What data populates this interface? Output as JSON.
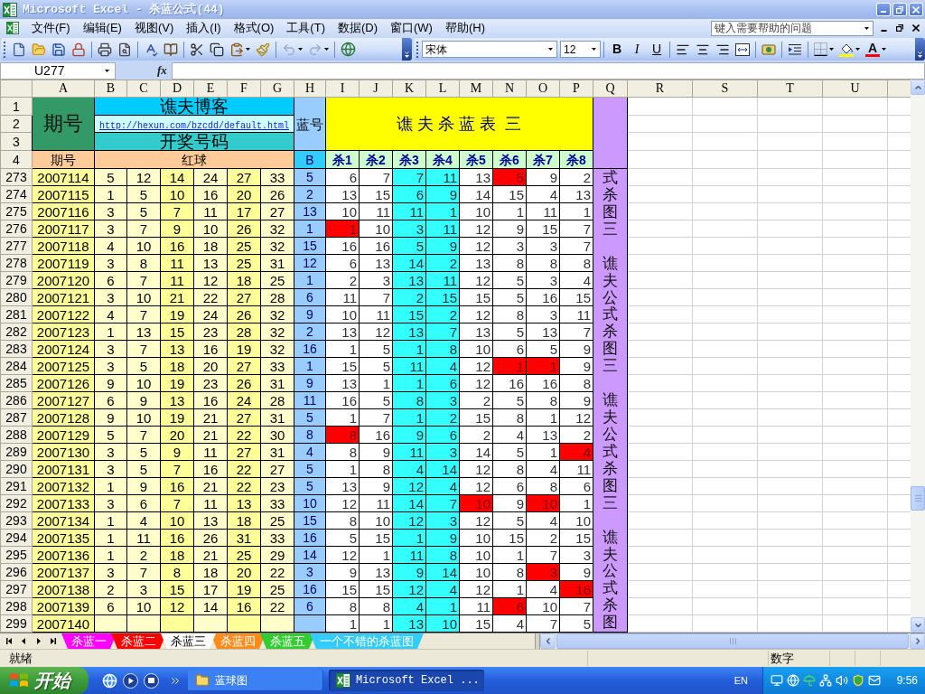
{
  "window": {
    "title": "Microsoft Excel - 杀蓝公式(44)"
  },
  "menu_bar": {
    "items": [
      "文件(F)",
      "编辑(E)",
      "视图(V)",
      "插入(I)",
      "格式(O)",
      "工具(T)",
      "数据(D)",
      "窗口(W)",
      "帮助(H)"
    ],
    "help_box": {
      "placeholder": "键入需要帮助的问题"
    }
  },
  "toolbar": {
    "undo": {
      "disabled": true
    },
    "redo": {
      "disabled": true
    },
    "font_name": "宋体",
    "font_size": "12",
    "format_buttons": [
      "B",
      "I",
      "U"
    ],
    "font_color_glyph": "A"
  },
  "formula_bar": {
    "name_box": "U277",
    "function_label": "fx"
  },
  "sheet": {
    "columns": [
      "A",
      "B",
      "C",
      "D",
      "E",
      "F",
      "G",
      "H",
      "I",
      "J",
      "K",
      "L",
      "M",
      "N",
      "O",
      "P",
      "Q",
      "R",
      "S",
      "T",
      "U"
    ],
    "header": {
      "row_numbers": [
        "1",
        "2",
        "3",
        "4"
      ],
      "period_label": "期号",
      "blog_title": "谯夫博客",
      "blog_link": "http://hexun.com/bzcdd/default.html",
      "draw_label": "开奖号码",
      "blue_label": "蓝号",
      "table_title": "谯 夫 杀 蓝 表  三",
      "period_heading": "期号",
      "red_heading": "红球",
      "blue_heading": "B",
      "kill_headings": [
        "杀1",
        "杀2",
        "杀3",
        "杀4",
        "杀5",
        "杀6",
        "杀7",
        "杀8"
      ]
    },
    "rows": [
      {
        "number": "273",
        "issue": "2007114",
        "reds": [
          "5",
          "12",
          "14",
          "24",
          "27",
          "33"
        ],
        "blue": "5",
        "kills": [
          {
            "value": "6",
            "hit": false
          },
          {
            "value": "7",
            "hit": false
          },
          {
            "value": "7",
            "hit": false
          },
          {
            "value": "11",
            "hit": false
          },
          {
            "value": "13",
            "hit": false
          },
          {
            "value": "5",
            "hit": true
          },
          {
            "value": "9",
            "hit": false
          },
          {
            "value": "2",
            "hit": false
          }
        ]
      },
      {
        "number": "274",
        "issue": "2007115",
        "reds": [
          "1",
          "5",
          "10",
          "16",
          "20",
          "26"
        ],
        "blue": "2",
        "kills": [
          {
            "value": "13",
            "hit": false
          },
          {
            "value": "15",
            "hit": false
          },
          {
            "value": "6",
            "hit": false
          },
          {
            "value": "9",
            "hit": false
          },
          {
            "value": "14",
            "hit": false
          },
          {
            "value": "15",
            "hit": false
          },
          {
            "value": "4",
            "hit": false
          },
          {
            "value": "13",
            "hit": false
          }
        ]
      },
      {
        "number": "275",
        "issue": "2007116",
        "reds": [
          "3",
          "5",
          "7",
          "11",
          "17",
          "27"
        ],
        "blue": "13",
        "kills": [
          {
            "value": "10",
            "hit": false
          },
          {
            "value": "11",
            "hit": false
          },
          {
            "value": "11",
            "hit": false
          },
          {
            "value": "1",
            "hit": false
          },
          {
            "value": "10",
            "hit": false
          },
          {
            "value": "1",
            "hit": false
          },
          {
            "value": "11",
            "hit": false
          },
          {
            "value": "1",
            "hit": false
          }
        ]
      },
      {
        "number": "276",
        "issue": "2007117",
        "reds": [
          "3",
          "7",
          "9",
          "10",
          "26",
          "32"
        ],
        "blue": "1",
        "kills": [
          {
            "value": "1",
            "hit": true
          },
          {
            "value": "10",
            "hit": false
          },
          {
            "value": "3",
            "hit": false
          },
          {
            "value": "11",
            "hit": false
          },
          {
            "value": "12",
            "hit": false
          },
          {
            "value": "9",
            "hit": false
          },
          {
            "value": "15",
            "hit": false
          },
          {
            "value": "7",
            "hit": false
          }
        ]
      },
      {
        "number": "277",
        "issue": "2007118",
        "reds": [
          "4",
          "10",
          "16",
          "18",
          "25",
          "32"
        ],
        "blue": "15",
        "kills": [
          {
            "value": "16",
            "hit": false
          },
          {
            "value": "16",
            "hit": false
          },
          {
            "value": "5",
            "hit": false
          },
          {
            "value": "9",
            "hit": false
          },
          {
            "value": "12",
            "hit": false
          },
          {
            "value": "3",
            "hit": false
          },
          {
            "value": "3",
            "hit": false
          },
          {
            "value": "7",
            "hit": false
          }
        ]
      },
      {
        "number": "278",
        "issue": "2007119",
        "reds": [
          "3",
          "8",
          "11",
          "13",
          "25",
          "31"
        ],
        "blue": "12",
        "kills": [
          {
            "value": "6",
            "hit": false
          },
          {
            "value": "13",
            "hit": false
          },
          {
            "value": "14",
            "hit": false
          },
          {
            "value": "2",
            "hit": false
          },
          {
            "value": "13",
            "hit": false
          },
          {
            "value": "8",
            "hit": false
          },
          {
            "value": "8",
            "hit": false
          },
          {
            "value": "8",
            "hit": false
          }
        ]
      },
      {
        "number": "279",
        "issue": "2007120",
        "reds": [
          "6",
          "7",
          "11",
          "12",
          "18",
          "25"
        ],
        "blue": "1",
        "kills": [
          {
            "value": "2",
            "hit": false
          },
          {
            "value": "3",
            "hit": false
          },
          {
            "value": "13",
            "hit": false
          },
          {
            "value": "11",
            "hit": false
          },
          {
            "value": "12",
            "hit": false
          },
          {
            "value": "5",
            "hit": false
          },
          {
            "value": "3",
            "hit": false
          },
          {
            "value": "4",
            "hit": false
          }
        ]
      },
      {
        "number": "280",
        "issue": "2007121",
        "reds": [
          "3",
          "10",
          "21",
          "22",
          "27",
          "28"
        ],
        "blue": "6",
        "kills": [
          {
            "value": "11",
            "hit": false
          },
          {
            "value": "7",
            "hit": false
          },
          {
            "value": "2",
            "hit": false
          },
          {
            "value": "15",
            "hit": false
          },
          {
            "value": "15",
            "hit": false
          },
          {
            "value": "5",
            "hit": false
          },
          {
            "value": "16",
            "hit": false
          },
          {
            "value": "15",
            "hit": false
          }
        ]
      },
      {
        "number": "281",
        "issue": "2007122",
        "reds": [
          "4",
          "7",
          "19",
          "24",
          "26",
          "32"
        ],
        "blue": "9",
        "kills": [
          {
            "value": "10",
            "hit": false
          },
          {
            "value": "11",
            "hit": false
          },
          {
            "value": "15",
            "hit": false
          },
          {
            "value": "2",
            "hit": false
          },
          {
            "value": "12",
            "hit": false
          },
          {
            "value": "8",
            "hit": false
          },
          {
            "value": "3",
            "hit": false
          },
          {
            "value": "11",
            "hit": false
          }
        ]
      },
      {
        "number": "282",
        "issue": "2007123",
        "reds": [
          "1",
          "13",
          "15",
          "23",
          "28",
          "32"
        ],
        "blue": "2",
        "kills": [
          {
            "value": "13",
            "hit": false
          },
          {
            "value": "12",
            "hit": false
          },
          {
            "value": "13",
            "hit": false
          },
          {
            "value": "7",
            "hit": false
          },
          {
            "value": "13",
            "hit": false
          },
          {
            "value": "5",
            "hit": false
          },
          {
            "value": "13",
            "hit": false
          },
          {
            "value": "7",
            "hit": false
          }
        ]
      },
      {
        "number": "283",
        "issue": "2007124",
        "reds": [
          "3",
          "7",
          "13",
          "16",
          "19",
          "32"
        ],
        "blue": "16",
        "kills": [
          {
            "value": "1",
            "hit": false
          },
          {
            "value": "5",
            "hit": false
          },
          {
            "value": "1",
            "hit": false
          },
          {
            "value": "8",
            "hit": false
          },
          {
            "value": "10",
            "hit": false
          },
          {
            "value": "6",
            "hit": false
          },
          {
            "value": "5",
            "hit": false
          },
          {
            "value": "9",
            "hit": false
          }
        ]
      },
      {
        "number": "284",
        "issue": "2007125",
        "reds": [
          "3",
          "5",
          "18",
          "20",
          "27",
          "33"
        ],
        "blue": "1",
        "kills": [
          {
            "value": "15",
            "hit": false
          },
          {
            "value": "5",
            "hit": false
          },
          {
            "value": "11",
            "hit": false
          },
          {
            "value": "4",
            "hit": false
          },
          {
            "value": "12",
            "hit": false
          },
          {
            "value": "1",
            "hit": true
          },
          {
            "value": "1",
            "hit": true
          },
          {
            "value": "9",
            "hit": false
          }
        ]
      },
      {
        "number": "285",
        "issue": "2007126",
        "reds": [
          "9",
          "10",
          "19",
          "23",
          "26",
          "31"
        ],
        "blue": "9",
        "kills": [
          {
            "value": "13",
            "hit": false
          },
          {
            "value": "1",
            "hit": false
          },
          {
            "value": "1",
            "hit": false
          },
          {
            "value": "6",
            "hit": false
          },
          {
            "value": "12",
            "hit": false
          },
          {
            "value": "16",
            "hit": false
          },
          {
            "value": "16",
            "hit": false
          },
          {
            "value": "8",
            "hit": false
          }
        ]
      },
      {
        "number": "286",
        "issue": "2007127",
        "reds": [
          "6",
          "9",
          "13",
          "16",
          "24",
          "28"
        ],
        "blue": "11",
        "kills": [
          {
            "value": "16",
            "hit": false
          },
          {
            "value": "5",
            "hit": false
          },
          {
            "value": "8",
            "hit": false
          },
          {
            "value": "3",
            "hit": false
          },
          {
            "value": "2",
            "hit": false
          },
          {
            "value": "5",
            "hit": false
          },
          {
            "value": "8",
            "hit": false
          },
          {
            "value": "9",
            "hit": false
          }
        ]
      },
      {
        "number": "287",
        "issue": "2007128",
        "reds": [
          "9",
          "10",
          "19",
          "21",
          "27",
          "31"
        ],
        "blue": "5",
        "kills": [
          {
            "value": "1",
            "hit": false
          },
          {
            "value": "7",
            "hit": false
          },
          {
            "value": "1",
            "hit": false
          },
          {
            "value": "2",
            "hit": false
          },
          {
            "value": "15",
            "hit": false
          },
          {
            "value": "8",
            "hit": false
          },
          {
            "value": "1",
            "hit": false
          },
          {
            "value": "12",
            "hit": false
          }
        ]
      },
      {
        "number": "288",
        "issue": "2007129",
        "reds": [
          "5",
          "7",
          "20",
          "21",
          "22",
          "30"
        ],
        "blue": "8",
        "kills": [
          {
            "value": "8",
            "hit": true
          },
          {
            "value": "16",
            "hit": false
          },
          {
            "value": "9",
            "hit": false
          },
          {
            "value": "6",
            "hit": false
          },
          {
            "value": "2",
            "hit": false
          },
          {
            "value": "4",
            "hit": false
          },
          {
            "value": "13",
            "hit": false
          },
          {
            "value": "2",
            "hit": false
          }
        ]
      },
      {
        "number": "289",
        "issue": "2007130",
        "reds": [
          "3",
          "5",
          "9",
          "11",
          "27",
          "31"
        ],
        "blue": "4",
        "kills": [
          {
            "value": "8",
            "hit": false
          },
          {
            "value": "9",
            "hit": false
          },
          {
            "value": "11",
            "hit": false
          },
          {
            "value": "3",
            "hit": false
          },
          {
            "value": "14",
            "hit": false
          },
          {
            "value": "5",
            "hit": false
          },
          {
            "value": "1",
            "hit": false
          },
          {
            "value": "4",
            "hit": true
          }
        ]
      },
      {
        "number": "290",
        "issue": "2007131",
        "reds": [
          "3",
          "5",
          "7",
          "16",
          "22",
          "27"
        ],
        "blue": "5",
        "kills": [
          {
            "value": "1",
            "hit": false
          },
          {
            "value": "8",
            "hit": false
          },
          {
            "value": "4",
            "hit": false
          },
          {
            "value": "14",
            "hit": false
          },
          {
            "value": "12",
            "hit": false
          },
          {
            "value": "8",
            "hit": false
          },
          {
            "value": "4",
            "hit": false
          },
          {
            "value": "11",
            "hit": false
          }
        ]
      },
      {
        "number": "291",
        "issue": "2007132",
        "reds": [
          "1",
          "9",
          "16",
          "21",
          "22",
          "23"
        ],
        "blue": "5",
        "kills": [
          {
            "value": "13",
            "hit": false
          },
          {
            "value": "9",
            "hit": false
          },
          {
            "value": "12",
            "hit": false
          },
          {
            "value": "4",
            "hit": false
          },
          {
            "value": "12",
            "hit": false
          },
          {
            "value": "6",
            "hit": false
          },
          {
            "value": "8",
            "hit": false
          },
          {
            "value": "6",
            "hit": false
          }
        ]
      },
      {
        "number": "292",
        "issue": "2007133",
        "reds": [
          "3",
          "6",
          "7",
          "11",
          "13",
          "33"
        ],
        "blue": "10",
        "kills": [
          {
            "value": "12",
            "hit": false
          },
          {
            "value": "11",
            "hit": false
          },
          {
            "value": "14",
            "hit": false
          },
          {
            "value": "7",
            "hit": false
          },
          {
            "value": "10",
            "hit": true
          },
          {
            "value": "9",
            "hit": false
          },
          {
            "value": "10",
            "hit": true
          },
          {
            "value": "1",
            "hit": false
          }
        ]
      },
      {
        "number": "293",
        "issue": "2007134",
        "reds": [
          "1",
          "4",
          "10",
          "13",
          "18",
          "25"
        ],
        "blue": "15",
        "kills": [
          {
            "value": "8",
            "hit": false
          },
          {
            "value": "10",
            "hit": false
          },
          {
            "value": "12",
            "hit": false
          },
          {
            "value": "3",
            "hit": false
          },
          {
            "value": "12",
            "hit": false
          },
          {
            "value": "5",
            "hit": false
          },
          {
            "value": "4",
            "hit": false
          },
          {
            "value": "10",
            "hit": false
          }
        ]
      },
      {
        "number": "294",
        "issue": "2007135",
        "reds": [
          "1",
          "11",
          "16",
          "26",
          "31",
          "33"
        ],
        "blue": "16",
        "kills": [
          {
            "value": "5",
            "hit": false
          },
          {
            "value": "15",
            "hit": false
          },
          {
            "value": "1",
            "hit": false
          },
          {
            "value": "9",
            "hit": false
          },
          {
            "value": "10",
            "hit": false
          },
          {
            "value": "15",
            "hit": false
          },
          {
            "value": "2",
            "hit": false
          },
          {
            "value": "15",
            "hit": false
          }
        ]
      },
      {
        "number": "295",
        "issue": "2007136",
        "reds": [
          "1",
          "2",
          "18",
          "21",
          "25",
          "29"
        ],
        "blue": "14",
        "kills": [
          {
            "value": "12",
            "hit": false
          },
          {
            "value": "1",
            "hit": false
          },
          {
            "value": "11",
            "hit": false
          },
          {
            "value": "8",
            "hit": false
          },
          {
            "value": "10",
            "hit": false
          },
          {
            "value": "1",
            "hit": false
          },
          {
            "value": "7",
            "hit": false
          },
          {
            "value": "3",
            "hit": false
          }
        ]
      },
      {
        "number": "296",
        "issue": "2007137",
        "reds": [
          "3",
          "7",
          "8",
          "18",
          "20",
          "22"
        ],
        "blue": "3",
        "kills": [
          {
            "value": "9",
            "hit": false
          },
          {
            "value": "13",
            "hit": false
          },
          {
            "value": "9",
            "hit": false
          },
          {
            "value": "14",
            "hit": false
          },
          {
            "value": "10",
            "hit": false
          },
          {
            "value": "8",
            "hit": false
          },
          {
            "value": "3",
            "hit": true
          },
          {
            "value": "9",
            "hit": false
          }
        ]
      },
      {
        "number": "297",
        "issue": "2007138",
        "reds": [
          "2",
          "3",
          "15",
          "17",
          "19",
          "25"
        ],
        "blue": "16",
        "kills": [
          {
            "value": "15",
            "hit": false
          },
          {
            "value": "15",
            "hit": false
          },
          {
            "value": "12",
            "hit": false
          },
          {
            "value": "4",
            "hit": false
          },
          {
            "value": "12",
            "hit": false
          },
          {
            "value": "1",
            "hit": false
          },
          {
            "value": "4",
            "hit": false
          },
          {
            "value": "16",
            "hit": true
          }
        ]
      },
      {
        "number": "298",
        "issue": "2007139",
        "reds": [
          "6",
          "10",
          "12",
          "14",
          "16",
          "22"
        ],
        "blue": "6",
        "kills": [
          {
            "value": "8",
            "hit": false
          },
          {
            "value": "8",
            "hit": false
          },
          {
            "value": "4",
            "hit": false
          },
          {
            "value": "1",
            "hit": false
          },
          {
            "value": "11",
            "hit": false
          },
          {
            "value": "6",
            "hit": true
          },
          {
            "value": "10",
            "hit": false
          },
          {
            "value": "7",
            "hit": false
          }
        ]
      },
      {
        "number": "299",
        "issue": "2007140",
        "kills": [
          {
            "value": "1",
            "hit": false
          },
          {
            "value": "1",
            "hit": false
          },
          {
            "value": "13",
            "hit": false
          },
          {
            "value": "10",
            "hit": false
          },
          {
            "value": "15",
            "hit": false
          },
          {
            "value": "4",
            "hit": false
          },
          {
            "value": "7",
            "hit": false
          },
          {
            "value": "5",
            "hit": false
          }
        ]
      }
    ],
    "side_label": [
      "式杀图三",
      "谯夫公式杀图三",
      "谯夫公式杀图三",
      "谯夫公式杀图"
    ]
  },
  "sheet_tabs": [
    {
      "label": "杀蓝一",
      "color": "#ff00ff",
      "selected": false
    },
    {
      "label": "杀蓝二",
      "color": "#ff0000",
      "selected": false
    },
    {
      "label": "杀蓝三",
      "selected": true
    },
    {
      "label": "杀蓝四",
      "color": "#ff8c1a",
      "selected": false
    },
    {
      "label": "杀蓝五",
      "color": "#33cc33",
      "selected": false
    },
    {
      "label": "一个不错的杀蓝图",
      "color": "#33ccff",
      "selected": false
    }
  ],
  "status_bar": {
    "status": "就绪",
    "mode": "数字"
  },
  "taskbar": {
    "start": "开始",
    "tasks": [
      {
        "label": "蓝球图",
        "selected": false
      },
      {
        "label": "Microsoft Excel ...",
        "selected": true
      }
    ],
    "language": "EN",
    "clock": "9:56"
  }
}
